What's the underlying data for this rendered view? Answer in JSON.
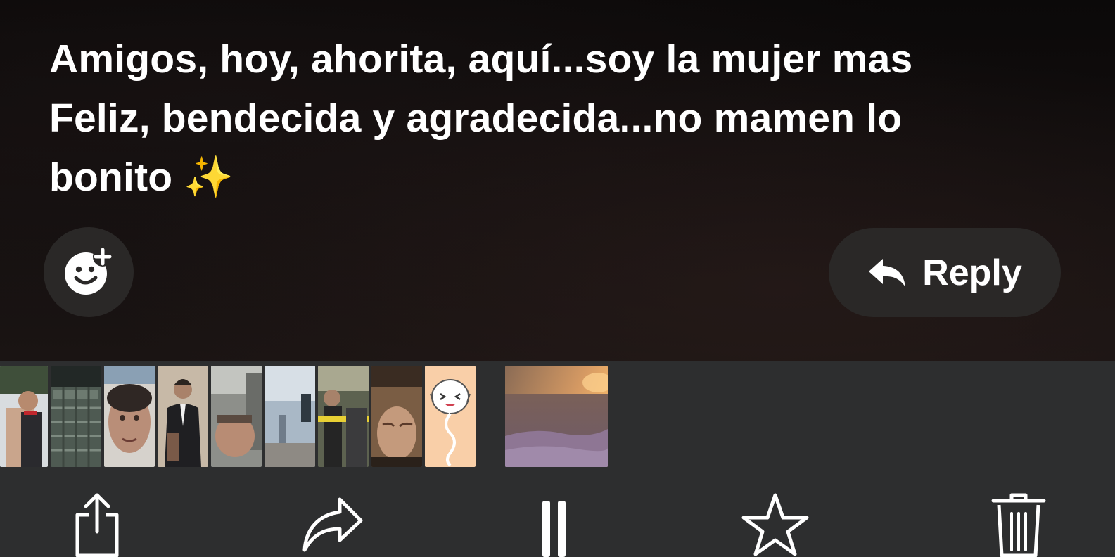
{
  "message": {
    "caption_lines": [
      "Amigos, hoy, ahorita, aquí...soy la mujer mas",
      "Feliz, bendecida y agradecida...no mamen lo",
      "bonito"
    ],
    "caption_emoji": "✨"
  },
  "actions": {
    "react_icon": "add-reaction-icon",
    "reply_icon": "reply-arrow-icon",
    "reply_label": "Reply"
  },
  "thumbnails": {
    "count": 11,
    "items": [
      {
        "kind": "photo",
        "accent": "#6d7b86"
      },
      {
        "kind": "photo",
        "accent": "#5c6a5c"
      },
      {
        "kind": "photo",
        "accent": "#b9a08e"
      },
      {
        "kind": "photo",
        "accent": "#c8b8a6"
      },
      {
        "kind": "photo",
        "accent": "#8a8a86"
      },
      {
        "kind": "photo",
        "accent": "#8fa2b8"
      },
      {
        "kind": "photo",
        "accent": "#5d6b5a"
      },
      {
        "kind": "photo",
        "accent": "#8a6f55"
      },
      {
        "kind": "sticker",
        "accent": "#f7d2b0"
      },
      {
        "kind": "photo",
        "accent": "#c98b63"
      }
    ]
  },
  "toolbar": {
    "items": [
      {
        "icon": "share-icon"
      },
      {
        "icon": "forward-icon"
      },
      {
        "icon": "pause-icon"
      },
      {
        "icon": "star-icon"
      },
      {
        "icon": "trash-icon"
      }
    ]
  },
  "colors": {
    "text": "#ffffff",
    "pill_bg": "#2a2827",
    "bar_bg": "#2d2e2f",
    "emoji": "#f5c542"
  }
}
